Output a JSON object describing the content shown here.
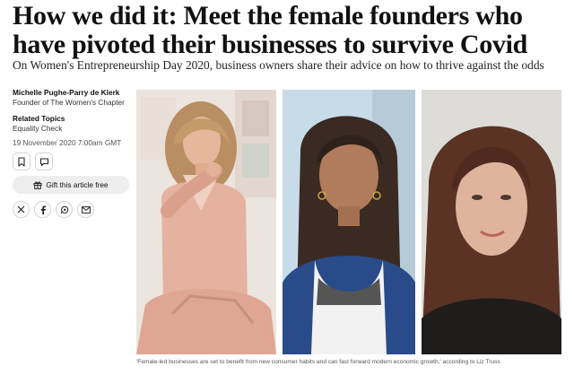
{
  "article": {
    "headline": "How we did it: Meet the female founders who have pivoted their businesses to survive Covid",
    "standfirst": "On Women's Entrepreneurship Day 2020, business owners share their advice on how to thrive against the odds",
    "author": {
      "name": "Michelle Pughe-Parry de Klerk",
      "role": "Founder of The Women's Chapter"
    },
    "related_topics_label": "Related Topics",
    "topic": "Equality Check",
    "date": "19 November 2020 7:00am GMT",
    "gift_label": "Gift this article free",
    "caption": "'Female-led businesses are set to benefit from new consumer habits and can fast forward modern economic growth,' according to Liz Truss"
  },
  "icons": {
    "bookmark": "bookmark-icon",
    "comment": "comment-icon",
    "gift": "gift-icon",
    "x": "x-logo-icon",
    "facebook": "facebook-icon",
    "whatsapp": "whatsapp-icon",
    "email": "email-icon"
  },
  "colors": {
    "text": "#111111",
    "muted": "#555555",
    "gift_button_bg": "#eeeeee"
  }
}
